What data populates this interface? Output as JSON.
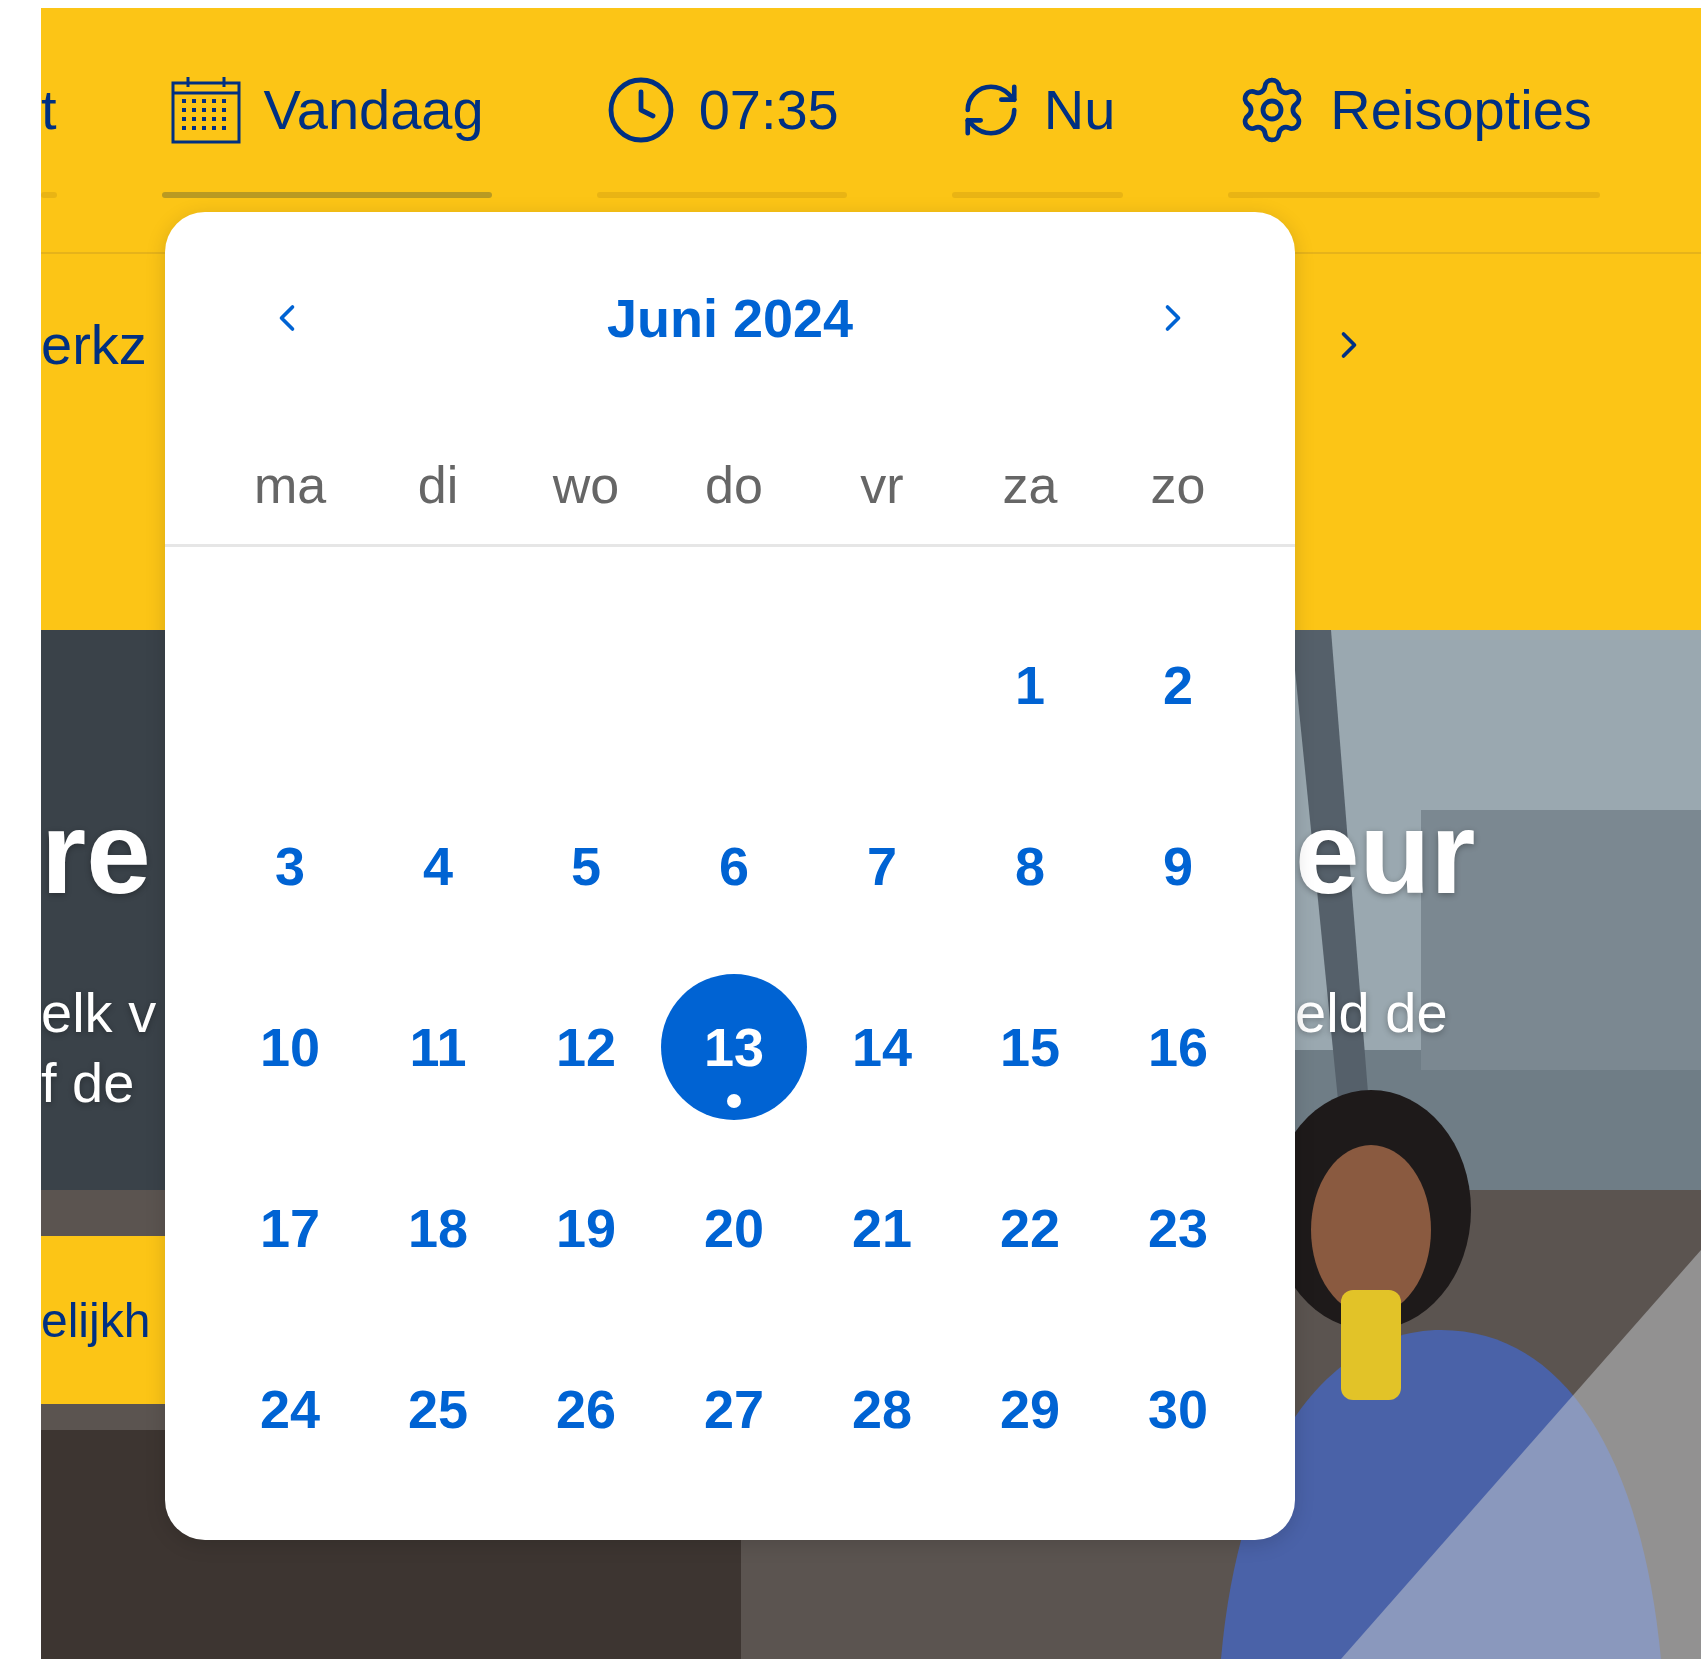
{
  "header": {
    "tabs": [
      {
        "kind": "fragment",
        "label": "t",
        "selected": false
      },
      {
        "kind": "date",
        "label": "Vandaag",
        "selected": true
      },
      {
        "kind": "time",
        "label": "07:35",
        "selected": false
      },
      {
        "kind": "now",
        "label": "Nu",
        "selected": false
      },
      {
        "kind": "options",
        "label": "Reisopties",
        "selected": false
      }
    ],
    "second_row_text": "erkz"
  },
  "hero": {
    "kind": "picture",
    "title_left": "re",
    "title_right": "eur",
    "lines_left": [
      "elk v",
      "f de"
    ],
    "line_right": "eld de",
    "banner_text": "elijkh"
  },
  "datepicker": {
    "month": "Juni 2024",
    "weekdays": [
      "ma",
      "di",
      "wo",
      "do",
      "vr",
      "za",
      "zo"
    ],
    "weeks": [
      [
        {
          "label": "1",
          "selected": false,
          "today": false
        },
        {
          "label": "2",
          "selected": false,
          "today": false
        }
      ],
      [
        {
          "label": "3",
          "selected": false,
          "today": false
        },
        {
          "label": "4",
          "selected": false,
          "today": false
        },
        {
          "label": "5",
          "selected": false,
          "today": false
        },
        {
          "label": "6",
          "selected": false,
          "today": false
        },
        {
          "label": "7",
          "selected": false,
          "today": false
        },
        {
          "label": "8",
          "selected": false,
          "today": false
        },
        {
          "label": "9",
          "selected": false,
          "today": false
        }
      ],
      [
        {
          "label": "10",
          "selected": false,
          "today": false
        },
        {
          "label": "11",
          "selected": false,
          "today": false
        },
        {
          "label": "12",
          "selected": false,
          "today": false
        },
        {
          "label": "13",
          "selected": true,
          "today": true
        },
        {
          "label": "14",
          "selected": false,
          "today": false
        },
        {
          "label": "15",
          "selected": false,
          "today": false
        },
        {
          "label": "16",
          "selected": false,
          "today": false
        }
      ],
      [
        {
          "label": "17",
          "selected": false,
          "today": false
        },
        {
          "label": "18",
          "selected": false,
          "today": false
        },
        {
          "label": "19",
          "selected": false,
          "today": false
        },
        {
          "label": "20",
          "selected": false,
          "today": false
        },
        {
          "label": "21",
          "selected": false,
          "today": false
        },
        {
          "label": "22",
          "selected": false,
          "today": false
        },
        {
          "label": "23",
          "selected": false,
          "today": false
        }
      ],
      [
        {
          "label": "24",
          "selected": false,
          "today": false
        },
        {
          "label": "25",
          "selected": false,
          "today": false
        },
        {
          "label": "26",
          "selected": false,
          "today": false
        },
        {
          "label": "27",
          "selected": false,
          "today": false
        },
        {
          "label": "28",
          "selected": false,
          "today": false
        },
        {
          "label": "29",
          "selected": false,
          "today": false
        },
        {
          "label": "30",
          "selected": false,
          "today": false
        }
      ]
    ]
  }
}
